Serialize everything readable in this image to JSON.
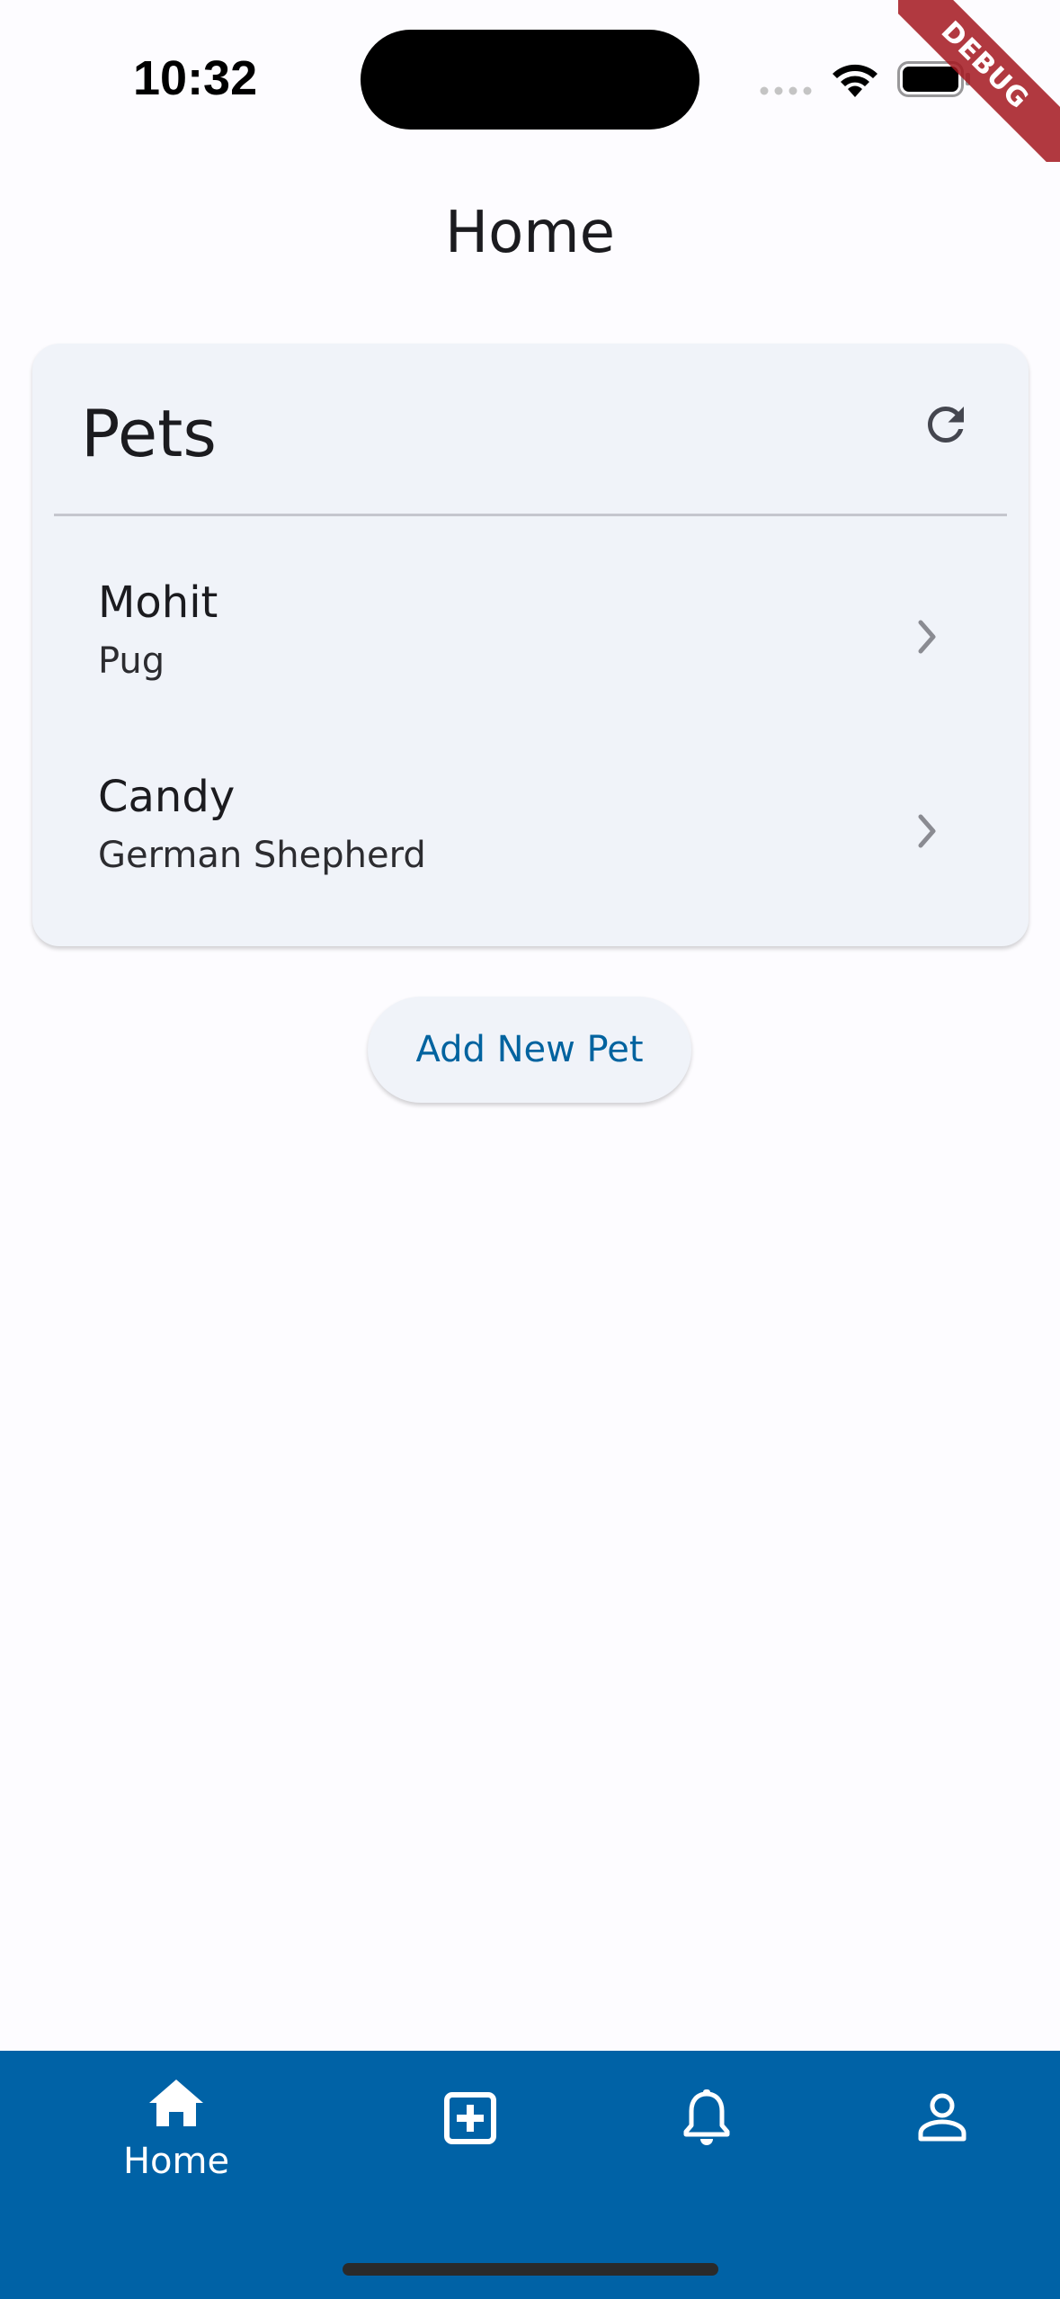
{
  "status_bar": {
    "time": "10:32",
    "debug_label": "DEBUG"
  },
  "app_bar": {
    "title": "Home"
  },
  "pets_card": {
    "title": "Pets",
    "refresh_icon": "refresh-icon",
    "items": [
      {
        "name": "Mohit",
        "breed": "Pug"
      },
      {
        "name": "Candy",
        "breed": "German Shepherd"
      }
    ]
  },
  "add_pet_button": {
    "label": "Add New Pet"
  },
  "bottom_nav": {
    "items": [
      {
        "icon": "home-icon",
        "label": "Home",
        "selected": true
      },
      {
        "icon": "add-box-icon",
        "label": "",
        "selected": false
      },
      {
        "icon": "bell-icon",
        "label": "",
        "selected": false
      },
      {
        "icon": "person-icon",
        "label": "",
        "selected": false
      }
    ]
  },
  "colors": {
    "primary": "#0062a6",
    "card_bg": "#f0f3f9",
    "button_text": "#00639f",
    "debug_ribbon": "#a3161e"
  }
}
